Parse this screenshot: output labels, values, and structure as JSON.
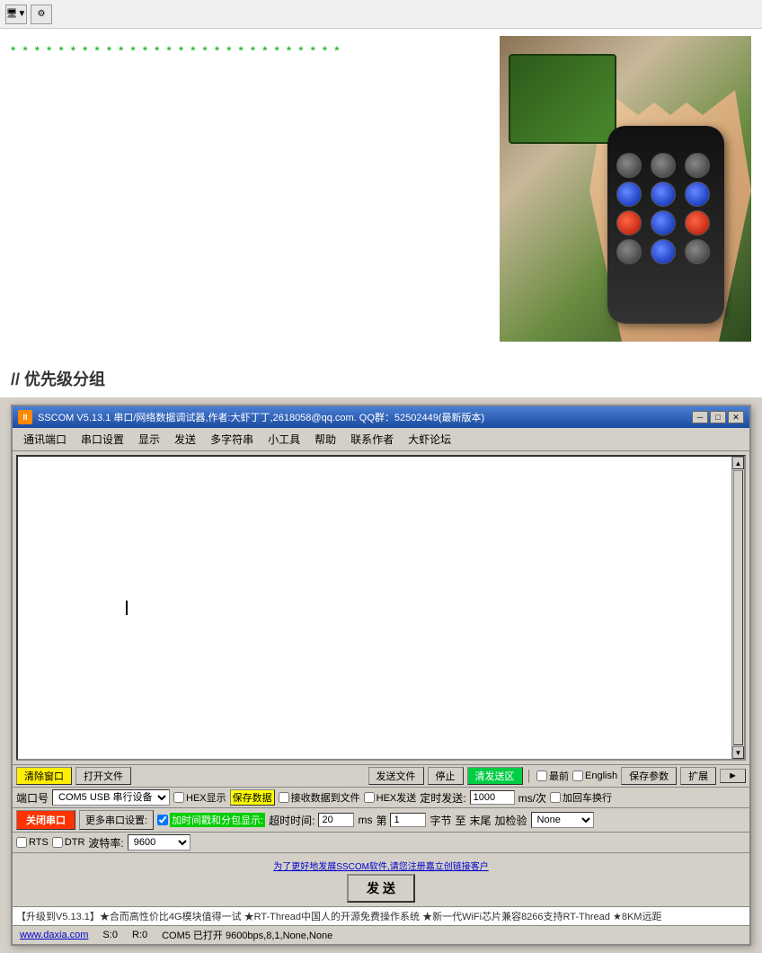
{
  "toolbar": {
    "icon1": "▼",
    "icon2": "⚙"
  },
  "green_stars": "* * * * * * * * * * * * * * * * * * * * * * * * * * * *",
  "heading": {
    "prefix": "//",
    "title": " 优先级分组"
  },
  "window": {
    "title": "SSCOM V5.13.1 串口/网络数据调试器,作者:大虾丁丁,2618058@qq.com. QQ群：52502449(最新版本)",
    "icon": "II",
    "controls": {
      "minimize": "─",
      "maximize": "□",
      "close": "✕"
    }
  },
  "menubar": {
    "items": [
      "通讯端口",
      "串口设置",
      "显示",
      "发送",
      "多字符串",
      "小工具",
      "帮助",
      "联系作者",
      "大虾论坛"
    ]
  },
  "bottom_bar1": {
    "clear_btn": "清除窗口",
    "open_file_btn": "打开文件",
    "send_file_btn": "发送文件",
    "stop_btn": "停止",
    "resend_btn": "清发送区",
    "last_checkbox": "最前",
    "english_checkbox": "English",
    "save_params_btn": "保存参数",
    "expand_btn": "扩展",
    "arrow_btn": "►"
  },
  "status_row": {
    "port_label": "端口号",
    "port_value": "COM5 USB 串行设备",
    "hex_display_checkbox": "HEX显示",
    "save_data_btn": "保存数据",
    "recv_to_file_checkbox": "接收数据到文件",
    "hex_send_checkbox": "HEX发送",
    "timed_send_label": "定时发送:",
    "timed_send_value": "1000",
    "timed_send_unit": "ms/次",
    "return_checkbox": "加回车换行"
  },
  "port_row": {
    "close_btn": "关闭串口",
    "more_settings_btn": "更多串口设置:",
    "timestamp_checkbox": "加时间戳和分包显示:",
    "timeout_label": "超时时间:",
    "timeout_value": "20",
    "timeout_unit": "ms",
    "page_label": "第",
    "page_value": "1",
    "byte_label": "字节",
    "to_label": "至",
    "end_label": "末尾",
    "checksum_label": "加检验",
    "checksum_value": "None",
    "rts_checkbox": "RTS",
    "dtr_checkbox": "DTR",
    "baud_label": "波特率:",
    "baud_value": "9600"
  },
  "promo": {
    "text": "为了更好地发展SSCOM软件,请您注册嘉立创链接客户"
  },
  "send_btn": "发 送",
  "ticker": "【升级到V5.13.1】★合而高性价比4G模块值得一试 ★RT-Thread中国人的开源免费操作系统 ★新一代WiFi芯片兼容8266支持RT-Thread ★8KM远距",
  "status_bottom": {
    "website": "www.daxia.com",
    "s_label": "S:0",
    "r_label": "R:0",
    "port_info": "COM5 已打开  9600bps,8,1,None,None"
  }
}
